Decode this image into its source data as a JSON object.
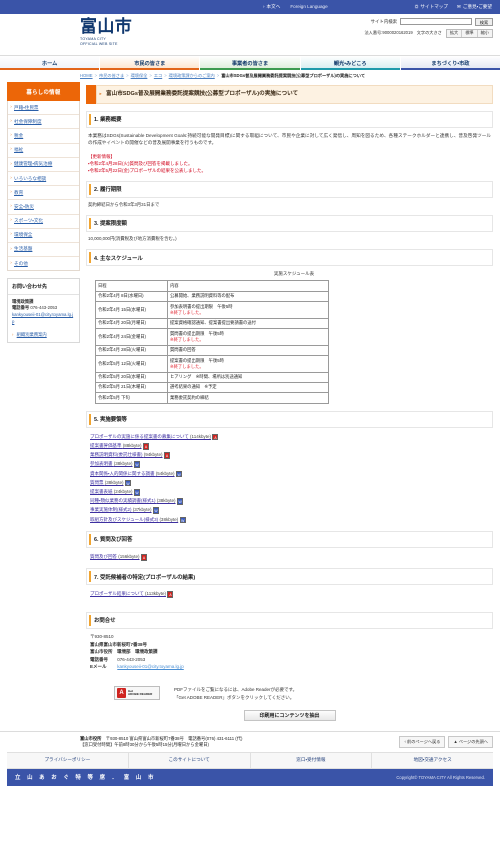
{
  "utilbar": {
    "skip_link": "本文へ",
    "foreign_language": "Foreign Language",
    "sitemap": "サイトマップ",
    "sitemap_icon": "sitemap-icon",
    "opinion": "ご意見・ご要望",
    "opinion_icon": "mail-icon"
  },
  "header": {
    "logo_main": "富山市",
    "logo_sub_line1": "TOYAMA CITY",
    "logo_sub_line2": "OFFICIAL WEB SITE",
    "search_label": "サイト内検索",
    "search_value": "",
    "search_placeholder": "",
    "search_button": "検索",
    "corporate_number": "法人番号:9000020162019",
    "text_size_label": "文字の大きさ",
    "size_large": "拡大",
    "size_normal": "標準",
    "size_small": "縮小"
  },
  "gnav": [
    {
      "label": "ホーム"
    },
    {
      "label": "市民の皆さま"
    },
    {
      "label": "事業者の皆さま"
    },
    {
      "label": "観光・みどころ"
    },
    {
      "label": "まちづくり・市政"
    }
  ],
  "breadcrumb": {
    "items": [
      "HOME",
      "市民の皆さま",
      "環境保全",
      "エコ",
      "環境政策課からのご案内"
    ],
    "current": "富山市SDGs普及展開業務委託提案競技(公募型プロポーザル)の実施について",
    "separator": ">"
  },
  "sidebar": {
    "heading": "暮らしの情報",
    "items": [
      {
        "label": "戸籍・住民票"
      },
      {
        "label": "社会保障制度"
      },
      {
        "label": "税金"
      },
      {
        "label": "福祉"
      },
      {
        "label": "健康管理・病気治療"
      },
      {
        "label": "いろいろな相談"
      },
      {
        "label": "教育"
      },
      {
        "label": "安全・防災"
      },
      {
        "label": "スポーツ・文化"
      },
      {
        "label": "環境保全"
      },
      {
        "label": "生活基盤"
      },
      {
        "label": "その他"
      }
    ],
    "contact": {
      "title": "お問い合わせ先",
      "department": "環境政策課",
      "tel_label": "電話番号",
      "tel": "076-443-2053",
      "email": "kankyouseii-01@city.toyama.lg.jp",
      "org_link": "組織別業務案内"
    }
  },
  "page": {
    "title": "富山市SDGs普及展開業務委託提案競技(公募型プロポーザル)の実施について",
    "sections": {
      "s1_heading": "1. 業務概要",
      "s1_body": "本業務はSDGs(Sustainable Development Goals:持続可能な開発目標)に関する取組について、市民や企業に対して広く発信し、周知を図るため、各種ステークホルダーと連携し、普及啓発ツールの作成やイベントの開催などの普及展開事業を行うものです。",
      "update_title": "【更新情報】",
      "update_lines": [
        "・令和2年4月28日(火)質問及び回答を掲載しました。",
        "・令和2年5月22日(金)プロポーザルの結果を公表しました。"
      ],
      "s2_heading": "2. 履行期限",
      "s2_body": "契約締結日から令和3年3月31日まで",
      "s3_heading": "3. 提案限度額",
      "s3_body": "10,000,000円(消費税及び地方消費税を含む。)",
      "s4_heading": "4. 主なスケジュール",
      "s5_heading": "5. 実施要領等",
      "s6_heading": "6. 質問及び回答",
      "s7_heading": "7. 受託候補者の特定(プロポーザルの結果)"
    },
    "schedule": {
      "caption": "実施スケジュール表",
      "columns": [
        "日程",
        "内容"
      ],
      "rows": [
        {
          "date": "令和2年4月 8日(水曜日)",
          "content": "公募開始、業務説明資料等の配布",
          "done": ""
        },
        {
          "date": "令和2年4月 15日(水曜日)",
          "content": "参加表明書の提出期限　午後5時",
          "done": "※終了しました。"
        },
        {
          "date": "令和2年4月 20日(月曜日)",
          "content": "提案資格確認通知、提案書提出要請書の送付",
          "done": ""
        },
        {
          "date": "令和2年4月 24日(金曜日)",
          "content": "質問書の提出期限　午後5時",
          "done": "※終了しました。"
        },
        {
          "date": "令和2年4月 28日(火曜日)",
          "content": "質問書の回答",
          "done": ""
        },
        {
          "date": "令和2年5月 12日(火曜日)",
          "content": "提案書の提出期限　午後5時",
          "done": "※終了しました。"
        },
        {
          "date": "令和2年5月 20日(水曜日)",
          "content": "ヒアリング　※時間、場所は別途通知",
          "done": ""
        },
        {
          "date": "令和2年5月 21日(木曜日)",
          "content": "選考結果の通知　※予定",
          "done": ""
        },
        {
          "date": "令和2年5月 下旬",
          "content": "業務委託契約の締結",
          "done": ""
        }
      ]
    },
    "guideline_files": [
      {
        "label": "プロポーザルの実施に係る提案書の募集について",
        "size": "(114kbyte)",
        "type": "pdf"
      },
      {
        "label": "提案書評価基準",
        "size": "(88kbyte)",
        "type": "pdf"
      },
      {
        "label": "業務説明資料(委託仕様書)",
        "size": "(94kbyte)",
        "type": "pdf"
      },
      {
        "label": "参加表明書",
        "size": "(38kbyte)",
        "type": "doc"
      },
      {
        "label": "資本関係・人的関係に関する調書",
        "size": "(54kbyte)",
        "type": "doc"
      },
      {
        "label": "質問票",
        "size": "(38kbyte)",
        "type": "doc"
      },
      {
        "label": "提案書表紙",
        "size": "(24kbyte)",
        "type": "doc"
      },
      {
        "label": "同種・類似業務の実績調書(様式1)",
        "size": "(38kbyte)",
        "type": "doc"
      },
      {
        "label": "事業実施体制(様式2)",
        "size": "(37kbyte)",
        "type": "doc"
      },
      {
        "label": "取組方針及びスケジュール(様式3)",
        "size": "(38kbyte)",
        "type": "doc"
      }
    ],
    "qa_files": [
      {
        "label": "質問及び回答",
        "size": "(156kbyte)",
        "type": "pdf"
      }
    ],
    "result_files": [
      {
        "label": "プロポーザル結果について",
        "size": "(113kbyte)",
        "type": "pdf"
      }
    ],
    "inquiry": {
      "heading": "お問合せ",
      "postal": "〒930-8510",
      "address": "富山県富山市新桜町7番38号",
      "office": "富山市役所　環境部　環境政策課",
      "tel_label": "電話番号",
      "tel": "076-443-2053",
      "email_label": "Eメール",
      "email": "kankyouseii-01@city.toyama.lg.jp"
    },
    "adobe": {
      "badge_line1": "Get",
      "badge_line2": "ADOBE READER",
      "badge_icon": "adobe-acrobat-icon",
      "note_line1": "PDFファイルをご覧になるには、Adobe Readerが必要です。",
      "note_line2": "「Get ADOBE READER」ボタンをクリックしてください。"
    },
    "print_button": "印刷用にコンテンツを抽出"
  },
  "footer": {
    "address_line1_a": "富山市役所　",
    "address_line1_b": "〒930-8510 富山県富山市新桜町7番38号　電話番号",
    "address_line1_c": "(076) 431-6111 (代)",
    "address_line2": "【窓口受付時間】午前8時30分から午後5時15分(月曜日から金曜日)",
    "btn_back": "‹ 前のページへ戻る",
    "btn_top": "▲ ページの先頭へ",
    "nav": [
      {
        "label": "プライバシーポリシー"
      },
      {
        "label": "このサイトについて"
      },
      {
        "label": "窓口・受付情報"
      },
      {
        "label": "地図・交通アクセス"
      }
    ],
    "slogan": "立 山 あ お ぐ 特 等 席 ． 富 山 市",
    "copyright": "Copyright© TOYAMA CITY All Rights Reserved."
  },
  "colors": {
    "brand_blue": "#3a54a8",
    "accent_orange": "#ec6608",
    "heading_bar": "#f0a431",
    "alert_red": "#d0021b",
    "link_blue": "#2b5fa8"
  }
}
